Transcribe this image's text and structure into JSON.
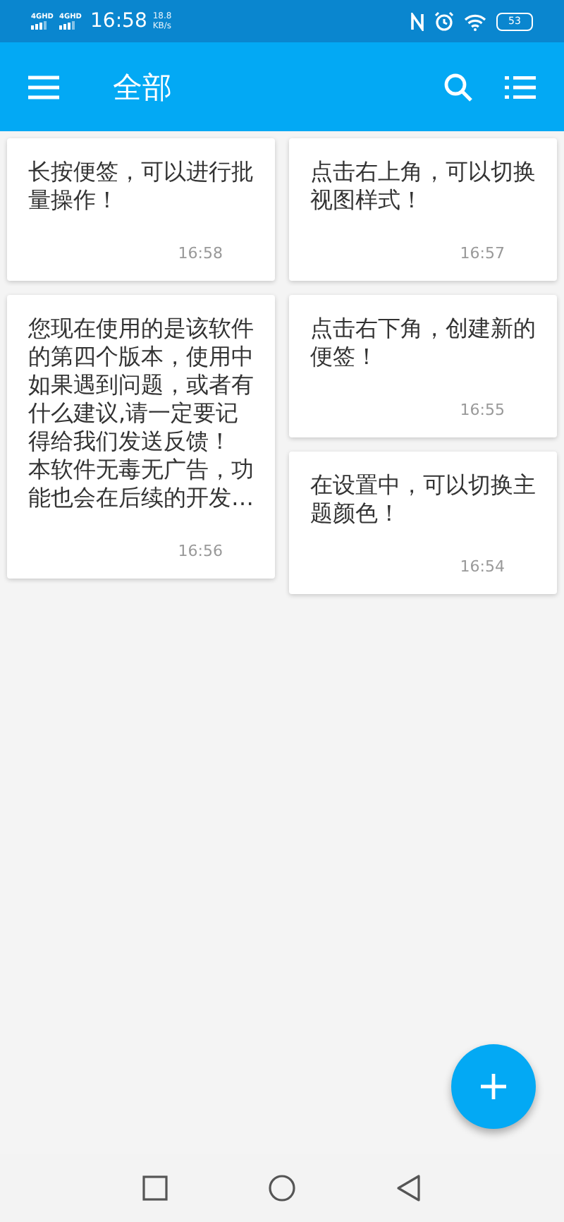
{
  "status_bar": {
    "network_labels": [
      "4GHD",
      "4GHD"
    ],
    "time": "16:58",
    "speed_value": "18.8",
    "speed_unit": "KB/s",
    "battery": "53"
  },
  "app_bar": {
    "title": "全部"
  },
  "columns": [
    [
      {
        "paragraphs": [
          "长按便签，可以进行批量操作！"
        ],
        "time": "16:58"
      },
      {
        "paragraphs": [
          "您现在使用的是该软件的第四个版本，使用中如果遇到问题，或者有什么建议,请一定要记得给我们发送反馈！",
          "本软件无毒无广告，功能也会在后续的开发…"
        ],
        "time": "16:56"
      }
    ],
    [
      {
        "paragraphs": [
          "点击右上角，可以切换视图样式！"
        ],
        "time": "16:57"
      },
      {
        "paragraphs": [
          "点击右下角，创建新的便签！"
        ],
        "time": "16:55"
      },
      {
        "paragraphs": [
          "在设置中，可以切换主题颜色！"
        ],
        "time": "16:54"
      }
    ]
  ]
}
